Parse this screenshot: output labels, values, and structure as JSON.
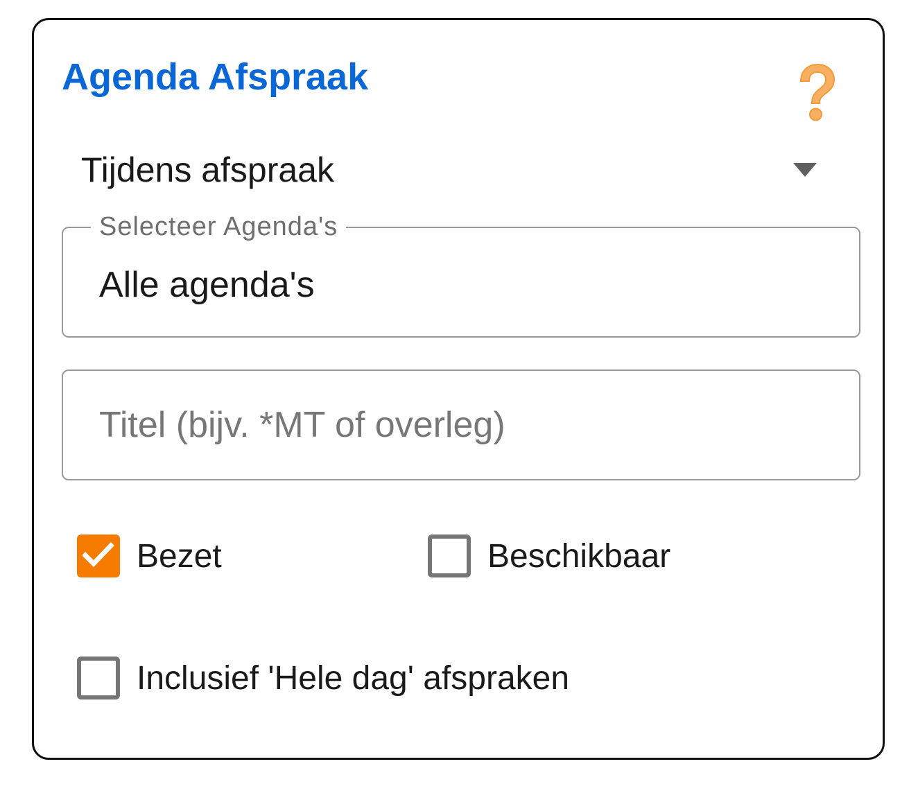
{
  "card": {
    "title": "Agenda Afspraak",
    "help_icon": "question-mark-icon"
  },
  "timing_dropdown": {
    "selected": "Tijdens afspraak",
    "arrow_icon": "caret-down-icon"
  },
  "calendar_select": {
    "label": "Selecteer Agenda's",
    "value": "Alle agenda's"
  },
  "title_input": {
    "value": "",
    "placeholder": "Titel (bijv. *MT of overleg)"
  },
  "checkboxes": {
    "busy": {
      "label": "Bezet",
      "checked": true
    },
    "available": {
      "label": "Beschikbaar",
      "checked": false
    },
    "all_day": {
      "label": "Inclusief 'Hele dag' afspraken",
      "checked": false
    }
  },
  "colors": {
    "title": "#0b66d6",
    "help_icon": "#f5a64a",
    "checkbox_checked": "#f57c00",
    "border": "#9a9a9a"
  }
}
